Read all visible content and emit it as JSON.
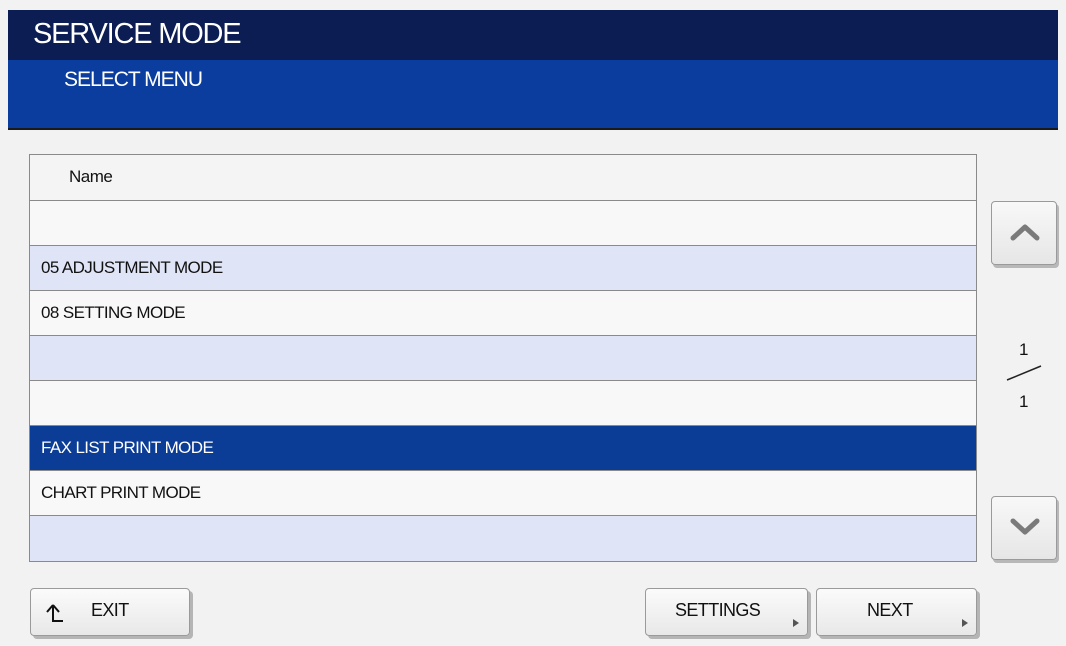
{
  "header": {
    "title": "SERVICE MODE",
    "subtitle": "SELECT MENU"
  },
  "list": {
    "column_header": "Name",
    "rows": [
      {
        "label": "",
        "selected": false
      },
      {
        "label": "05 ADJUSTMENT MODE",
        "selected": false
      },
      {
        "label": "08 SETTING MODE",
        "selected": false
      },
      {
        "label": "",
        "selected": false
      },
      {
        "label": "",
        "selected": false
      },
      {
        "label": "FAX LIST PRINT MODE",
        "selected": true
      },
      {
        "label": "CHART PRINT MODE",
        "selected": false
      },
      {
        "label": "",
        "selected": false
      }
    ]
  },
  "pagination": {
    "current": "1",
    "total": "1"
  },
  "buttons": {
    "exit": "EXIT",
    "settings": "SETTINGS",
    "next": "NEXT"
  },
  "icons": {
    "scroll_up": "chevron-up-icon",
    "scroll_down": "chevron-down-icon",
    "exit": "return-arrow-icon"
  },
  "colors": {
    "title_bar": "#0b1d52",
    "sub_bar": "#0a3d9e",
    "selected_row": "#0b3c96",
    "alt_row": "#dfe4f6"
  }
}
